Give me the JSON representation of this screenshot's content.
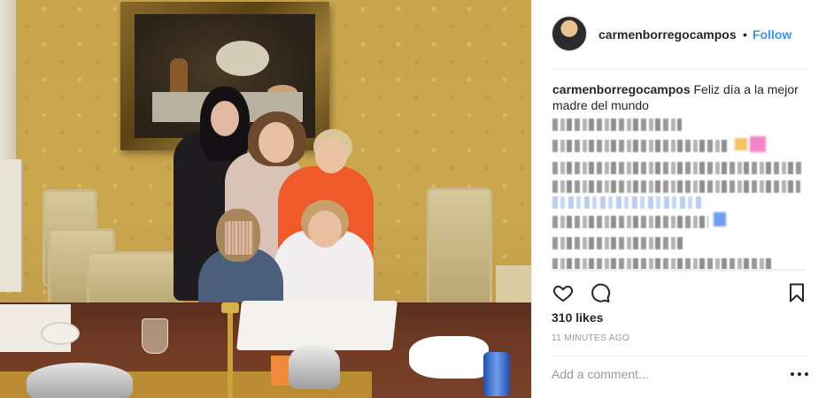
{
  "post": {
    "username": "carmenborregocampos",
    "separator": "•",
    "follow_label": "Follow",
    "caption_user": "carmenborregocampos",
    "caption_text": "Feliz día a la mejor madre del mundo",
    "likes": "310 likes",
    "timestamp": "11 MINUTES AGO",
    "comment_placeholder": "Add a comment..."
  },
  "colors": {
    "follow": "#3897f0",
    "text": "#262626",
    "muted": "#999999"
  },
  "icons": {
    "like": "heart-icon",
    "comment": "speech-bubble-icon",
    "save": "bookmark-icon",
    "more": "ellipsis-icon"
  }
}
